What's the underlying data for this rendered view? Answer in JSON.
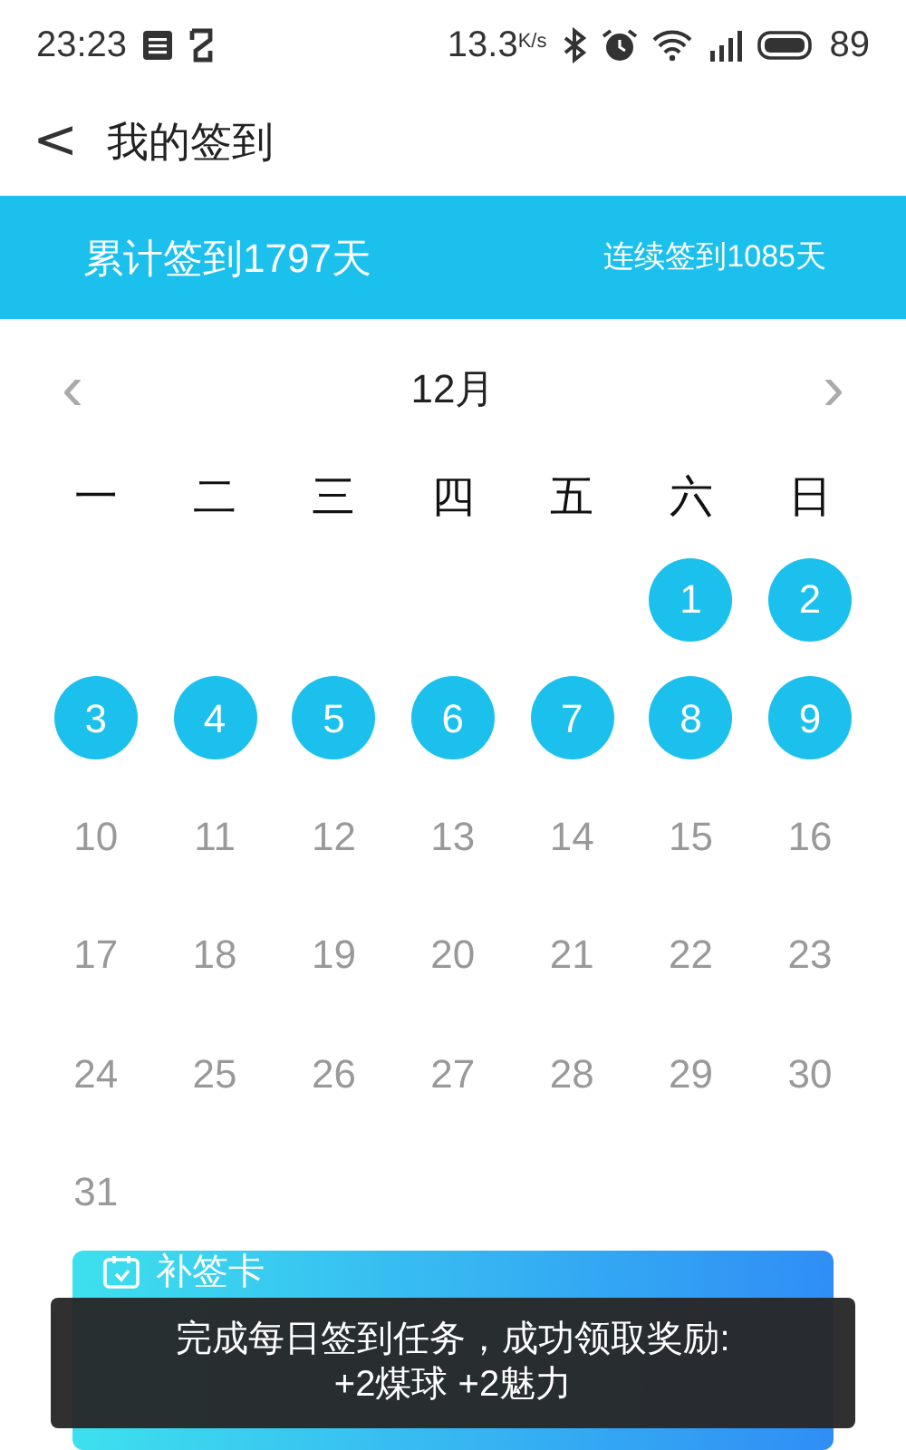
{
  "status_bar": {
    "time": "23:23",
    "speed": "13.3",
    "speed_unit": "K/s",
    "battery": "89"
  },
  "header": {
    "back": "<",
    "title": "我的签到"
  },
  "summary": {
    "total": "累计签到1797天",
    "streak": "连续签到1085天"
  },
  "calendar": {
    "prev": "‹",
    "month": "12月",
    "next": "›",
    "weekdays": [
      "一",
      "二",
      "三",
      "四",
      "五",
      "六",
      "日"
    ],
    "weeks": [
      {
        "days": [
          {
            "kind": "blank"
          },
          {
            "kind": "blank"
          },
          {
            "kind": "blank"
          },
          {
            "kind": "blank"
          },
          {
            "kind": "blank"
          },
          {
            "kind": "day",
            "day": "1",
            "signed": true
          },
          {
            "kind": "day",
            "day": "2",
            "signed": true
          }
        ]
      },
      {
        "days": [
          {
            "day": "3",
            "signed": true
          },
          {
            "day": "4",
            "signed": true
          },
          {
            "day": "5",
            "signed": true
          },
          {
            "day": "6",
            "signed": true
          },
          {
            "day": "7",
            "signed": true
          },
          {
            "day": "8",
            "signed": true
          },
          {
            "day": "9",
            "signed": true
          }
        ]
      },
      {
        "days": [
          {
            "day": "10",
            "signed": false
          },
          {
            "day": "11",
            "signed": false
          },
          {
            "day": "12",
            "signed": false
          },
          {
            "day": "13",
            "signed": false
          },
          {
            "day": "14",
            "signed": false
          },
          {
            "day": "15",
            "signed": false
          },
          {
            "day": "16",
            "signed": false
          }
        ]
      },
      {
        "days": [
          {
            "day": "17",
            "signed": false
          },
          {
            "day": "18",
            "signed": false
          },
          {
            "day": "19",
            "signed": false
          },
          {
            "day": "20",
            "signed": false
          },
          {
            "day": "21",
            "signed": false
          },
          {
            "day": "22",
            "signed": false
          },
          {
            "day": "23",
            "signed": false
          }
        ]
      },
      {
        "days": [
          {
            "day": "24",
            "signed": false
          },
          {
            "day": "25",
            "signed": false
          },
          {
            "day": "26",
            "signed": false
          },
          {
            "day": "27",
            "signed": false
          },
          {
            "day": "28",
            "signed": false
          },
          {
            "day": "29",
            "signed": false
          },
          {
            "day": "30",
            "signed": false
          }
        ]
      },
      {
        "days": [
          {
            "day": "31",
            "signed": false
          }
        ]
      }
    ]
  },
  "card": {
    "title": "补签卡"
  },
  "toast": {
    "line1": "完成每日签到任务，成功领取奖励:",
    "line2": "+2煤球 +2魅力"
  }
}
